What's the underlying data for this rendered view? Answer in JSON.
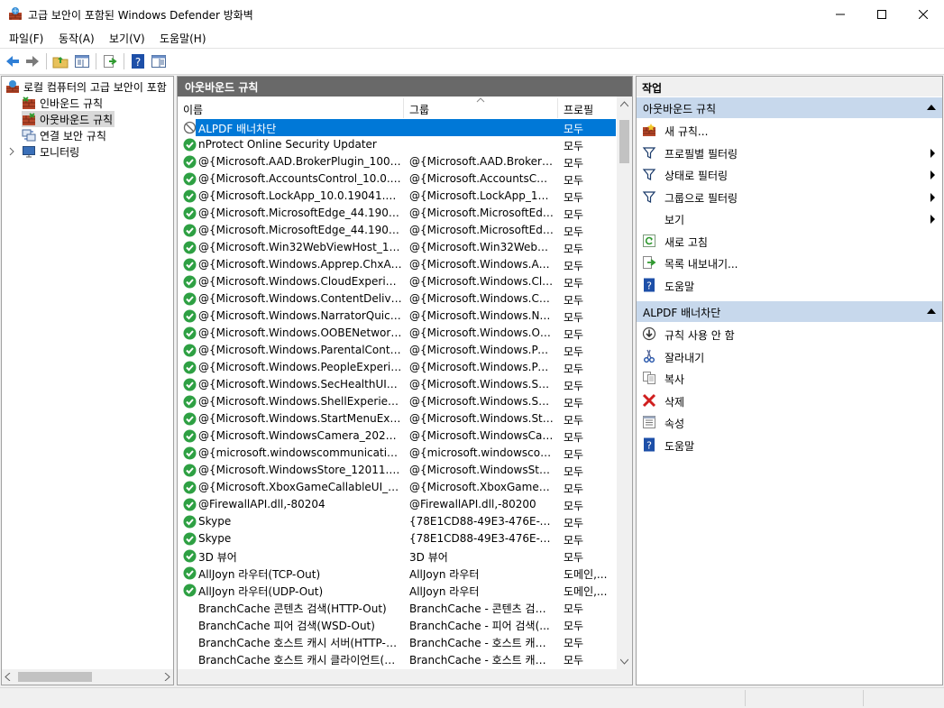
{
  "window": {
    "title": "고급 보안이 포함된 Windows Defender 방화벽"
  },
  "menu": [
    "파일(F)",
    "동작(A)",
    "보기(V)",
    "도움말(H)"
  ],
  "left": {
    "root": "로컬 컴퓨터의 고급 보안이 포함",
    "items": [
      {
        "label": "인바운드 규칙",
        "icon": "inbound-rules-icon"
      },
      {
        "label": "아웃바운드 규칙",
        "icon": "outbound-rules-icon"
      },
      {
        "label": "연결 보안 규칙",
        "icon": "connection-security-icon"
      },
      {
        "label": "모니터링",
        "icon": "monitor-icon"
      }
    ]
  },
  "center": {
    "title": "아웃바운드 규칙",
    "columns": [
      "이름",
      "그룹",
      "프로필"
    ],
    "rows": [
      {
        "name": "ALPDF 배너차단",
        "group": "",
        "profile": "모두",
        "status": "blocked"
      },
      {
        "name": "nProtect Online Security Updater",
        "group": "",
        "profile": "모두",
        "status": "allowed"
      },
      {
        "name": "@{Microsoft.AAD.BrokerPlugin_1000.19...",
        "group": "@{Microsoft.AAD.BrokerPlu...",
        "profile": "모두",
        "status": "allowed"
      },
      {
        "name": "@{Microsoft.AccountsControl_10.0.190...",
        "group": "@{Microsoft.AccountsCont...",
        "profile": "모두",
        "status": "allowed"
      },
      {
        "name": "@{Microsoft.LockApp_10.0.19041.1_ne...",
        "group": "@{Microsoft.LockApp_10.0....",
        "profile": "모두",
        "status": "allowed"
      },
      {
        "name": "@{Microsoft.MicrosoftEdge_44.19041.1....",
        "group": "@{Microsoft.MicrosoftEdge...",
        "profile": "모두",
        "status": "allowed"
      },
      {
        "name": "@{Microsoft.MicrosoftEdge_44.19041.4...",
        "group": "@{Microsoft.MicrosoftEdge...",
        "profile": "모두",
        "status": "allowed"
      },
      {
        "name": "@{Microsoft.Win32WebViewHost_10.0....",
        "group": "@{Microsoft.Win32WebVie...",
        "profile": "모두",
        "status": "allowed"
      },
      {
        "name": "@{Microsoft.Windows.Apprep.ChxApp_...",
        "group": "@{Microsoft.Windows.Appr...",
        "profile": "모두",
        "status": "allowed"
      },
      {
        "name": "@{Microsoft.Windows.CloudExperience...",
        "group": "@{Microsoft.Windows.Clou...",
        "profile": "모두",
        "status": "allowed"
      },
      {
        "name": "@{Microsoft.Windows.ContentDelivery...",
        "group": "@{Microsoft.Windows.Cont...",
        "profile": "모두",
        "status": "allowed"
      },
      {
        "name": "@{Microsoft.Windows.NarratorQuickSta...",
        "group": "@{Microsoft.Windows.Narr...",
        "profile": "모두",
        "status": "allowed"
      },
      {
        "name": "@{Microsoft.Windows.OOBENetworkCa...",
        "group": "@{Microsoft.Windows.OOB...",
        "profile": "모두",
        "status": "allowed"
      },
      {
        "name": "@{Microsoft.Windows.ParentalControls_...",
        "group": "@{Microsoft.Windows.Pare...",
        "profile": "모두",
        "status": "allowed"
      },
      {
        "name": "@{Microsoft.Windows.PeopleExperience...",
        "group": "@{Microsoft.Windows.Peop...",
        "profile": "모두",
        "status": "allowed"
      },
      {
        "name": "@{Microsoft.Windows.SecHealthUI_10.0....",
        "group": "@{Microsoft.Windows.Sec...",
        "profile": "모두",
        "status": "allowed"
      },
      {
        "name": "@{Microsoft.Windows.ShellExperienceH...",
        "group": "@{Microsoft.Windows.Shell...",
        "profile": "모두",
        "status": "allowed"
      },
      {
        "name": "@{Microsoft.Windows.StartMenuExperie...",
        "group": "@{Microsoft.Windows.Start...",
        "profile": "모두",
        "status": "allowed"
      },
      {
        "name": "@{Microsoft.WindowsCamera_2020.902....",
        "group": "@{Microsoft.WindowsCam...",
        "profile": "모두",
        "status": "allowed"
      },
      {
        "name": "@{microsoft.windowscommunicationsa...",
        "group": "@{microsoft.windowscom...",
        "profile": "모두",
        "status": "allowed"
      },
      {
        "name": "@{Microsoft.WindowsStore_12011.100...",
        "group": "@{Microsoft.WindowsStore...",
        "profile": "모두",
        "status": "allowed"
      },
      {
        "name": "@{Microsoft.XboxGameCallableUI_1000....",
        "group": "@{Microsoft.XboxGameCall...",
        "profile": "모두",
        "status": "allowed"
      },
      {
        "name": "@FirewallAPI.dll,-80204",
        "group": "@FirewallAPI.dll,-80200",
        "profile": "모두",
        "status": "allowed"
      },
      {
        "name": "Skype",
        "group": "{78E1CD88-49E3-476E-B9...",
        "profile": "모두",
        "status": "allowed"
      },
      {
        "name": "Skype",
        "group": "{78E1CD88-49E3-476E-B9...",
        "profile": "모두",
        "status": "allowed"
      },
      {
        "name": "3D 뷰어",
        "group": "3D 뷰어",
        "profile": "모두",
        "status": "allowed"
      },
      {
        "name": "AllJoyn 라우터(TCP-Out)",
        "group": "AllJoyn 라우터",
        "profile": "도메인,...",
        "status": "allowed"
      },
      {
        "name": "AllJoyn 라우터(UDP-Out)",
        "group": "AllJoyn 라우터",
        "profile": "도메인,...",
        "status": "allowed"
      },
      {
        "name": "BranchCache 콘텐츠 검색(HTTP-Out)",
        "group": "BranchCache - 콘텐츠 검색...",
        "profile": "모두",
        "status": "none"
      },
      {
        "name": "BranchCache 피어 검색(WSD-Out)",
        "group": "BranchCache - 피어 검색(...",
        "profile": "모두",
        "status": "none"
      },
      {
        "name": "BranchCache 호스트 캐시 서버(HTTP-O...",
        "group": "BranchCache - 호스트 캐시...",
        "profile": "모두",
        "status": "none"
      },
      {
        "name": "BranchCache 호스트 캐시 클라이언트(H...",
        "group": "BranchCache - 호스트 캐시...",
        "profile": "모두",
        "status": "none"
      }
    ]
  },
  "right": {
    "title": "작업",
    "section1": {
      "title": "아웃바운드 규칙",
      "actions": [
        {
          "label": "새 규칙...",
          "icon": "new-rule-icon",
          "submenu": false
        },
        {
          "label": "프로필별 필터링",
          "icon": "filter-icon",
          "submenu": true
        },
        {
          "label": "상태로 필터링",
          "icon": "filter-icon",
          "submenu": true
        },
        {
          "label": "그룹으로 필터링",
          "icon": "filter-icon",
          "submenu": true
        },
        {
          "label": "보기",
          "icon": "",
          "submenu": true
        },
        {
          "label": "새로 고침",
          "icon": "refresh-icon",
          "submenu": false
        },
        {
          "label": "목록 내보내기...",
          "icon": "export-icon",
          "submenu": false
        },
        {
          "label": "도움말",
          "icon": "help-icon",
          "submenu": false
        }
      ]
    },
    "section2": {
      "title": "ALPDF 배너차단",
      "actions": [
        {
          "label": "규칙 사용 안 함",
          "icon": "disable-rule-icon"
        },
        {
          "label": "잘라내기",
          "icon": "cut-icon"
        },
        {
          "label": "복사",
          "icon": "copy-icon"
        },
        {
          "label": "삭제",
          "icon": "delete-icon"
        },
        {
          "label": "속성",
          "icon": "properties-icon"
        },
        {
          "label": "도움말",
          "icon": "help-icon"
        }
      ]
    }
  },
  "colors": {
    "selection": "#0078d7",
    "section": "#c7d8ec",
    "paneHeader": "#696969",
    "allowGreen": "#2ea043"
  }
}
